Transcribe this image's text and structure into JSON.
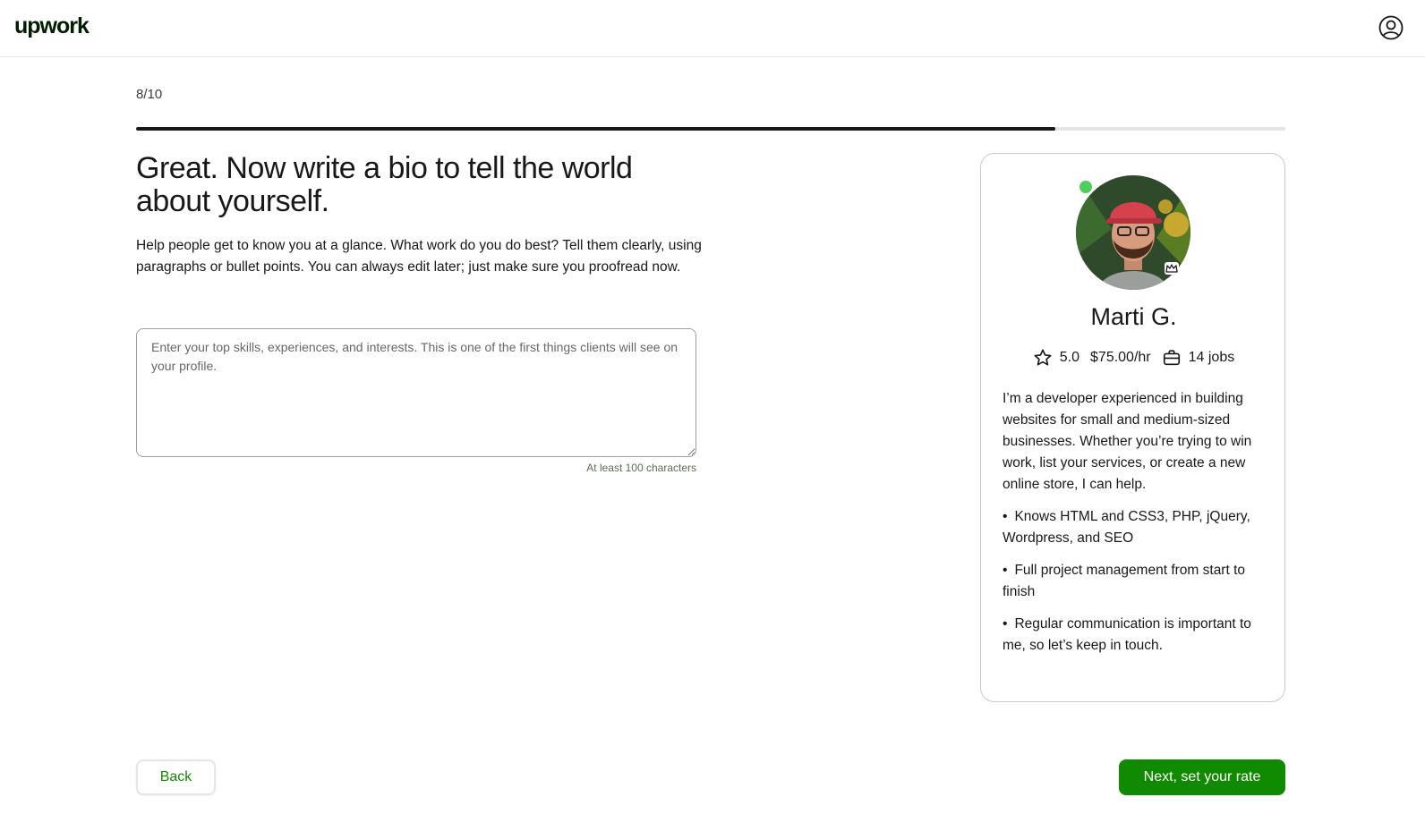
{
  "header": {
    "logo_text": "upwork",
    "account_icon": "user-circle-icon"
  },
  "progress": {
    "step_label": "8/10",
    "current": 8,
    "total": 10
  },
  "main": {
    "title": "Great. Now write a bio to tell the world about yourself.",
    "description": "Help people get to know you at a glance. What work do you do best? Tell them clearly, using paragraphs or bullet points. You can always edit later; just make sure you proofread now.",
    "bio_field": {
      "value": "",
      "placeholder": "Enter your top skills, experiences, and interests. This is one of the first things clients will see on your profile."
    },
    "char_hint": "At least 100 characters"
  },
  "profile_card": {
    "name": "Marti G.",
    "rating": "5.0",
    "rate": "$75.00/hr",
    "jobs": "14 jobs",
    "bio_intro": "I’m a developer experienced in building websites for small and medium-sized businesses. Whether you’re trying to win work, list your services, or create a new online store, I can help.",
    "bullets": [
      "Knows HTML and CSS3, PHP, jQuery, Wordpress, and SEO",
      "Full project management from start to finish",
      "Regular communication is important to me, so let’s keep in touch."
    ],
    "online_color": "#4fce5d"
  },
  "footer": {
    "back_label": "Back",
    "next_label": "Next, set your rate"
  },
  "colors": {
    "brand_green": "#108a00",
    "progress_fill": "#181818"
  }
}
